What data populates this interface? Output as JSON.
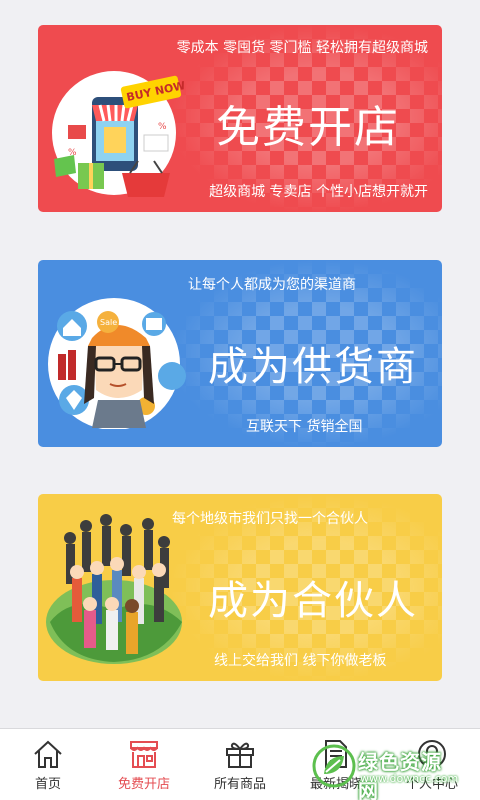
{
  "banners": {
    "shop": {
      "tagline_top": "零成本 零囤货 零门槛 轻松拥有超级商城",
      "headline": "免费开店",
      "tagline_bottom": "超级商城 专卖店 个性小店想开就开",
      "badge": "BUY NOW"
    },
    "supplier": {
      "tagline_top": "让每个人都成为您的渠道商",
      "headline": "成为供货商",
      "tagline_bottom": "互联天下 货销全国",
      "badge": "Sale"
    },
    "partner": {
      "tagline_top": "每个地级市我们只找一个合伙人",
      "headline": "成为合伙人",
      "tagline_bottom": "线上交给我们 线下你做老板"
    }
  },
  "tabbar": {
    "items": [
      {
        "label": "首页",
        "icon": "home-icon"
      },
      {
        "label": "免费开店",
        "icon": "storefront-icon"
      },
      {
        "label": "所有商品",
        "icon": "gift-icon"
      },
      {
        "label": "最新揭晓",
        "icon": "document-icon"
      },
      {
        "label": "个人中心",
        "icon": "user-icon"
      }
    ],
    "active_index": 1
  },
  "watermark": {
    "title": "绿色资源网",
    "url": "www.downcc.com"
  },
  "colors": {
    "red": "#ef4b4f",
    "blue": "#4a8ee0",
    "yellow": "#f8cd47",
    "active_tab": "#e44d52"
  }
}
